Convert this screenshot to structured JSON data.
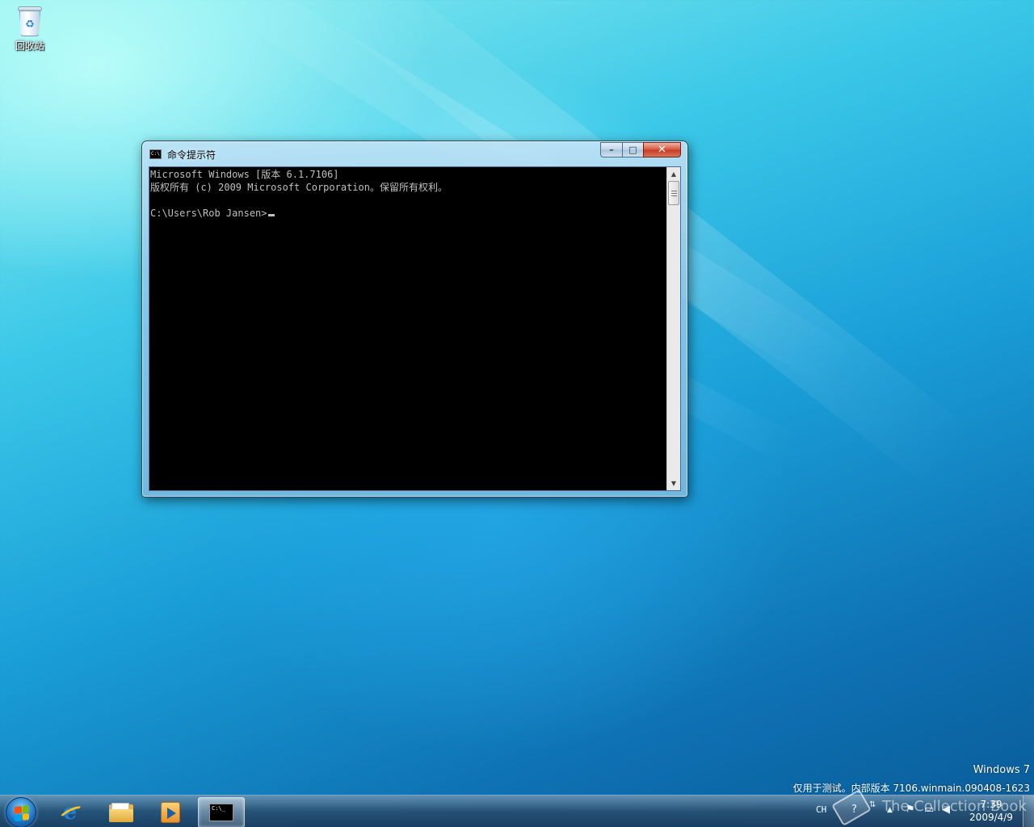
{
  "desktop": {
    "icons": [
      {
        "label": "回收站",
        "icon": "recycle-bin-icon"
      }
    ]
  },
  "window": {
    "title": "命令提示符",
    "icon_text": "C:\\",
    "buttons": {
      "minimize": "–",
      "maximize": "□",
      "close": "✕"
    },
    "console_lines": [
      "Microsoft Windows [版本 6.1.7106]",
      "版权所有 (c) 2009 Microsoft Corporation。保留所有权利。",
      "",
      "C:\\Users\\Rob Jansen>"
    ]
  },
  "watermark": {
    "line1": "Windows 7",
    "line2": "仅用于测试。内部版本 7106.winmain.090408-1623"
  },
  "taskbar": {
    "pinned": [
      {
        "name": "internet-explorer",
        "icon": "ie-icon"
      },
      {
        "name": "windows-explorer",
        "icon": "folder-icon"
      },
      {
        "name": "windows-media-player",
        "icon": "media-player-icon"
      },
      {
        "name": "command-prompt",
        "icon": "cmd-icon",
        "active": true
      }
    ],
    "cmd_icon_text": "C:\\_",
    "language": "CH",
    "overlay_text": "The Collection Book",
    "clock": {
      "time": "7:39",
      "date": "2009/4/9"
    }
  }
}
